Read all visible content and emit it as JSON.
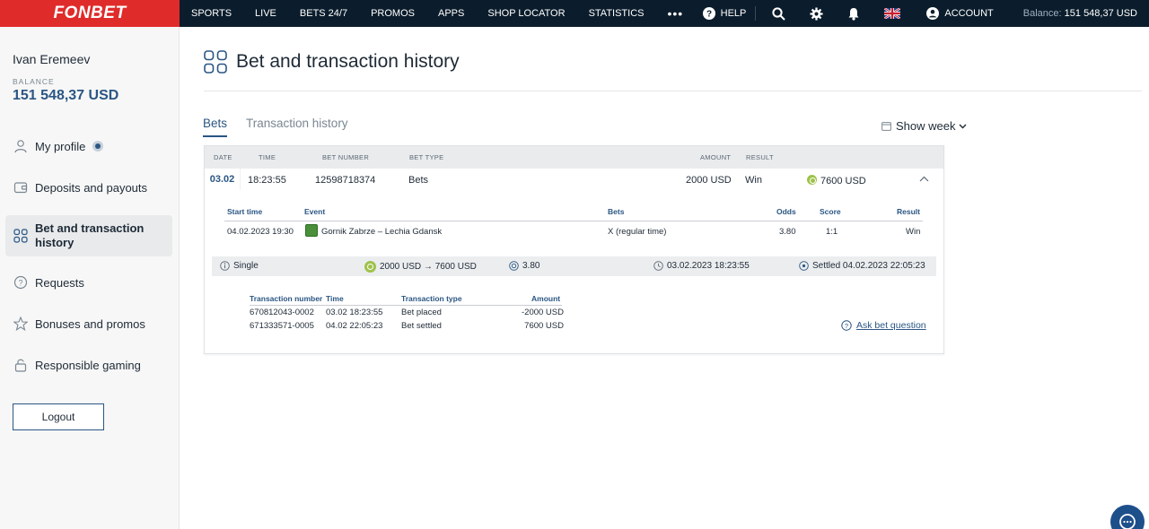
{
  "topbar": {
    "logo": "FONBET",
    "nav": [
      "SPORTS",
      "LIVE",
      "BETS 24/7",
      "PROMOS",
      "APPS",
      "SHOP LOCATOR",
      "STATISTICS"
    ],
    "more": "•••",
    "help": "HELP",
    "account": "ACCOUNT",
    "balance_label": "Balance:",
    "balance_value": "151 548,37 USD"
  },
  "sidebar": {
    "user_name": "Ivan Eremeev",
    "balance_label": "BALANCE",
    "balance_value": "151 548,37 USD",
    "items": [
      {
        "label": "My profile",
        "icon": "user-icon"
      },
      {
        "label": "Deposits and payouts",
        "icon": "wallet-icon"
      },
      {
        "label": "Bet and transaction history",
        "icon": "grid-icon"
      },
      {
        "label": "Requests",
        "icon": "question-icon"
      },
      {
        "label": "Bonuses and promos",
        "icon": "star-icon"
      },
      {
        "label": "Responsible gaming",
        "icon": "lock-icon"
      }
    ],
    "logout": "Logout"
  },
  "main": {
    "title": "Bet and transaction history",
    "tabs": [
      "Bets",
      "Transaction history"
    ],
    "period": "Show week",
    "table": {
      "headers": [
        "DATE",
        "TIME",
        "BET NUMBER",
        "BET TYPE",
        "AMOUNT",
        "RESULT"
      ],
      "row": {
        "date": "03.02",
        "time": "18:23:55",
        "bet_number": "12598718374",
        "bet_type": "Bets",
        "amount": "2000 USD",
        "result": "Win",
        "payout": "7600 USD"
      },
      "details": {
        "headers": [
          "Start time",
          "Event",
          "Bets",
          "Odds",
          "Score",
          "Result"
        ],
        "row": {
          "start_time": "04.02.2023 19:30",
          "event": "Gornik Zabrze – Lechia Gdansk",
          "bets": "X (regular time)",
          "odds": "3.80",
          "score": "1:1",
          "result": "Win"
        }
      },
      "summary": {
        "type": "Single",
        "amounts": "2000 USD → 7600 USD",
        "odds": "3.80",
        "placed": "03.02.2023 18:23:55",
        "settled": "Settled 04.02.2023 22:05:23"
      },
      "transactions": {
        "headers": [
          "Transaction number",
          "Time",
          "Transaction type",
          "Amount"
        ],
        "rows": [
          {
            "number": "670812043-0002",
            "time": "03.02 18:23:55",
            "type": "Bet placed",
            "amount": "-2000 USD"
          },
          {
            "number": "671333571-0005",
            "time": "04.02 22:05:23",
            "type": "Bet settled",
            "amount": "7600 USD"
          }
        ]
      },
      "ask": "Ask bet question"
    }
  },
  "colors": {
    "brand_red": "#e02b2b",
    "navy": "#0b1d2c",
    "accent_blue": "#2a5683",
    "win_green": "#9ec24a"
  }
}
